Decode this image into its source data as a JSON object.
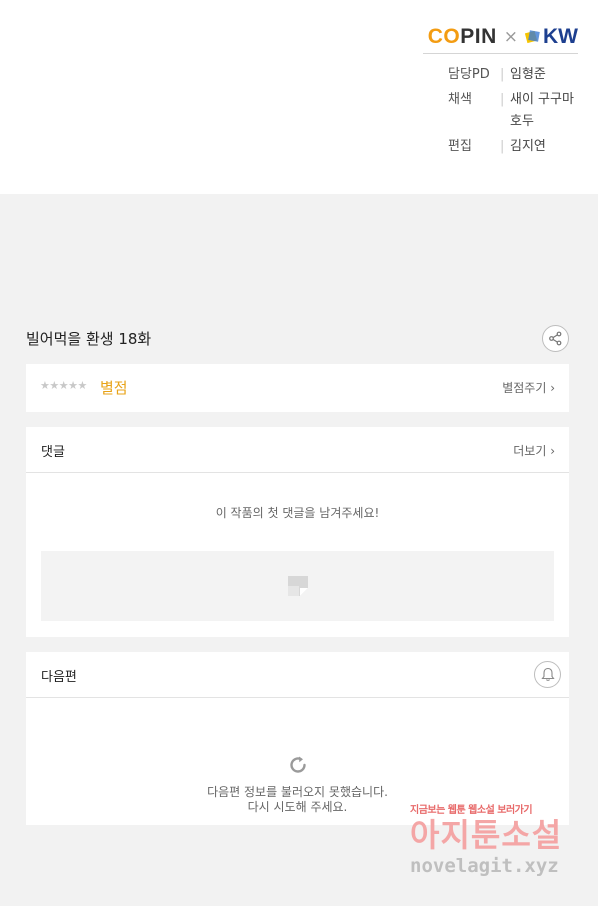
{
  "credits_panel": {
    "logos": {
      "copin_prefix": "CO",
      "copin_suffix": "PIN",
      "separator": "×",
      "kw": "KW"
    },
    "rows": [
      {
        "role": "담당PD",
        "names": "임형준"
      },
      {
        "role": "채색",
        "names": "새이 구구마 호두"
      },
      {
        "role": "편집",
        "names": "김지연"
      }
    ]
  },
  "episode": {
    "title": "빌어먹을 환생 18화"
  },
  "rating": {
    "stars": "★★★★★",
    "label": "별점",
    "rate_button": "별점주기 ›"
  },
  "comments": {
    "title": "댓글",
    "more_button": "더보기 ›",
    "empty_message": "이 작품의 첫 댓글을 남겨주세요!"
  },
  "next_episode": {
    "title": "다음편",
    "error_line1": "다음편 정보를 불러오지 못했습니다.",
    "error_line2": "다시 시도해 주세요."
  },
  "watermark": {
    "tagline": "지금보는 웹툰 웹소설 보러가기",
    "name": "아지툰소설",
    "url": "novelagit.xyz"
  },
  "colors": {
    "accent_orange": "#e8a317",
    "kw_blue": "#1d3f8f",
    "background": "#f2f2f2"
  }
}
